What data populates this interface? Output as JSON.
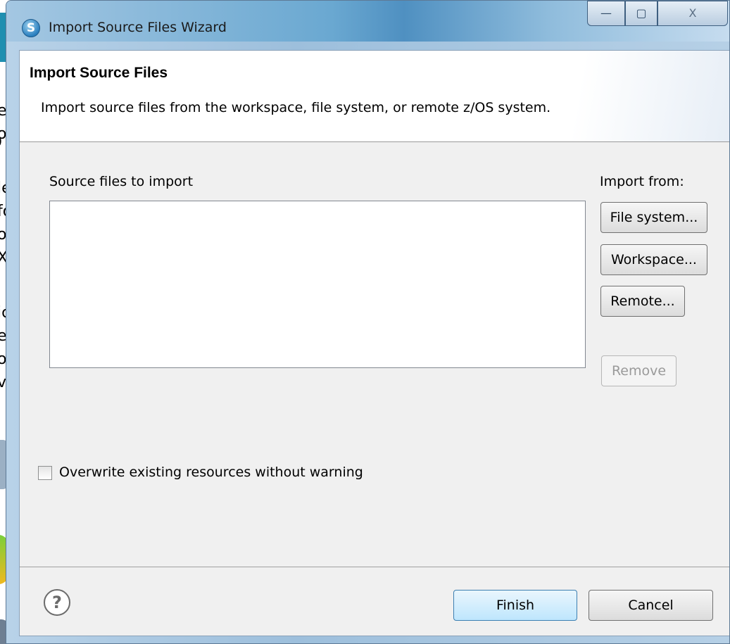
{
  "background_window": {
    "fragments": [
      "er",
      "o",
      "D",
      "le",
      "fo",
      "o",
      "XI",
      "ic",
      "e",
      "o",
      "vi"
    ]
  },
  "titlebar": {
    "title": "Import Source Files Wizard",
    "icon": "wizard-app-icon",
    "minimize_glyph": "—",
    "maximize_glyph": "▢",
    "close_glyph": "X"
  },
  "header": {
    "title": "Import Source Files",
    "description": "Import source files from the workspace, file system, or remote z/OS system."
  },
  "main": {
    "source_list_label": "Source files to import",
    "import_from_label": "Import from:",
    "buttons": {
      "file_system": "File system...",
      "workspace": "Workspace...",
      "remote": "Remote...",
      "remove": "Remove"
    },
    "overwrite_checkbox_label": "Overwrite existing resources without warning",
    "overwrite_checked": false
  },
  "footer": {
    "help_glyph": "?",
    "finish_label": "Finish",
    "cancel_label": "Cancel"
  },
  "colors": {
    "titlebar_accent": "#4f90c1",
    "dialog_body": "#f0f0f0",
    "default_button_border": "#3c7fb1"
  }
}
